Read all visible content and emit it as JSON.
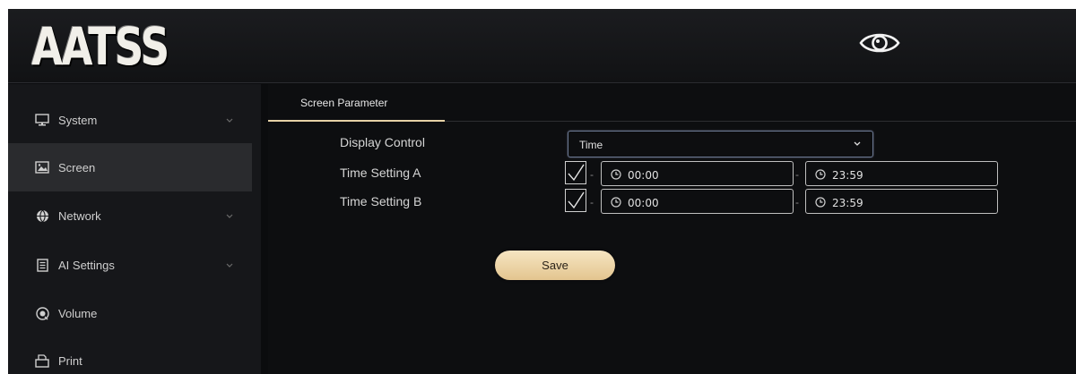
{
  "header": {
    "logo_text": "AATSS",
    "preview_icon": "eye-icon"
  },
  "sidebar": {
    "items": [
      {
        "label": "System",
        "icon": "monitor-icon",
        "expandable": true,
        "active": false
      },
      {
        "label": "Screen",
        "icon": "image-icon",
        "expandable": false,
        "active": true
      },
      {
        "label": "Network",
        "icon": "globe-icon",
        "expandable": true,
        "active": false
      },
      {
        "label": "AI Settings",
        "icon": "document-icon",
        "expandable": true,
        "active": false
      },
      {
        "label": "Volume",
        "icon": "volume-icon",
        "expandable": false,
        "active": false
      },
      {
        "label": "Print",
        "icon": "printer-icon",
        "expandable": false,
        "active": false
      }
    ]
  },
  "main": {
    "tab_label": "Screen Parameter",
    "display_control": {
      "label": "Display Control",
      "value": "Time"
    },
    "time_a": {
      "label": "Time Setting A",
      "checked": true,
      "start": "00:00",
      "end": "23:59"
    },
    "time_b": {
      "label": "Time Setting B",
      "checked": true,
      "start": "00:00",
      "end": "23:59"
    },
    "separator": "-",
    "save_label": "Save"
  },
  "colors": {
    "accent": "#e6d2a6",
    "background": "#0d0e10",
    "sidebar": "#16171a",
    "active_item": "#2a2b2e"
  }
}
